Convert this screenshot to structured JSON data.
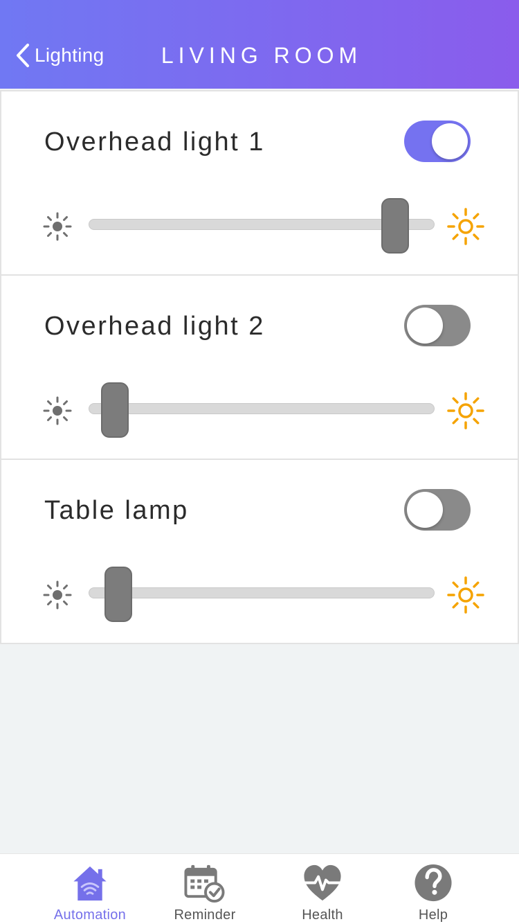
{
  "header": {
    "back_label": "Lighting",
    "title": "LIVING ROOM"
  },
  "lights": [
    {
      "label": "Overhead light 1",
      "on": true,
      "brightness": 0.92
    },
    {
      "label": "Overhead light 2",
      "on": false,
      "brightness": 0.04
    },
    {
      "label": "Table lamp",
      "on": false,
      "brightness": 0.05
    }
  ],
  "tabs": [
    {
      "label": "Automation",
      "icon": "home-wifi-icon",
      "active": true
    },
    {
      "label": "Reminder",
      "icon": "calendar-check-icon",
      "active": false
    },
    {
      "label": "Health",
      "icon": "heart-pulse-icon",
      "active": false
    },
    {
      "label": "Help",
      "icon": "help-icon",
      "active": false
    }
  ],
  "colors": {
    "accent": "#7572f0",
    "header_start": "#7078f3",
    "header_end": "#8a5cec",
    "sun_bright": "#f5a300",
    "toggle_off": "#8a8a8a"
  }
}
